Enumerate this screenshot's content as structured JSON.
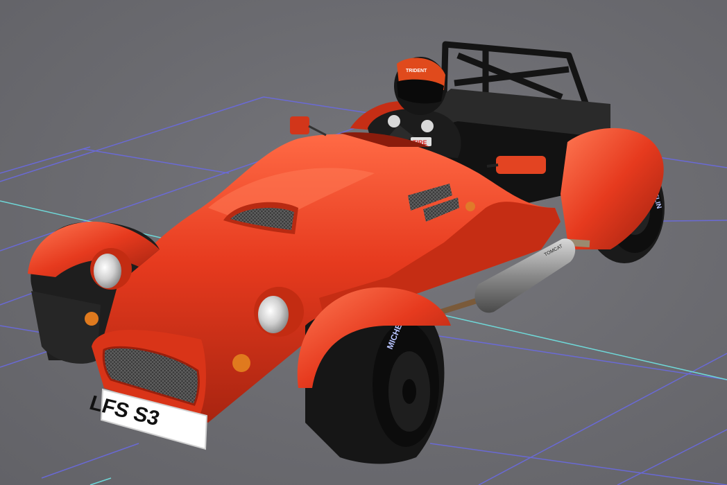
{
  "scene": {
    "background_color": "#6e6e73",
    "grid_color": "#6a6ae8",
    "axis_color": "#6fd8d8"
  },
  "car": {
    "body_color": "#e63a1e",
    "license_plate": "LFS S3",
    "tire_brand": "MICHELIN",
    "helmet_brand": "TRIDENT",
    "suit_sponsor": "TIRE",
    "exhaust_label": "TOMCAT"
  }
}
